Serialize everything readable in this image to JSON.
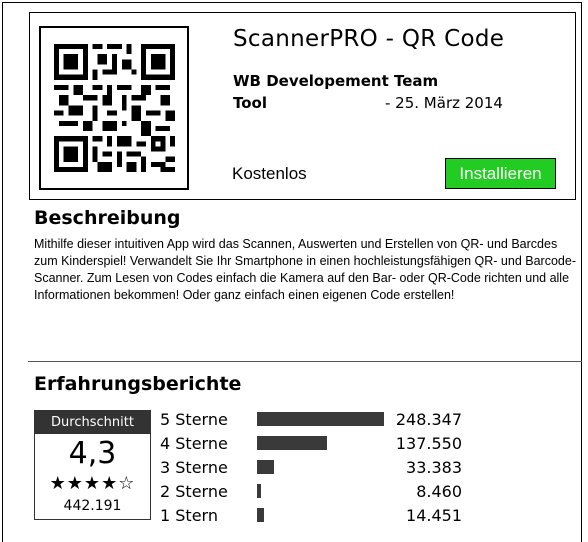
{
  "app": {
    "title": "ScannerPRO - QR Code",
    "developer": "WB Developement Team",
    "category": "Tool",
    "release_date": "- 25. März 2014",
    "price": "Kostenlos",
    "install_label": "Installieren",
    "install_color": "#22cc22",
    "qr_icon": "qr-code-icon"
  },
  "description": {
    "title": "Beschreibung",
    "text": "Mithilfe dieser intuitiven App wird das Scannen, Auswerten und Erstellen von QR- und Barcdes zum Kinderspiel! Verwandelt Sie Ihr Smartphone in einen hochleistungsfähigen QR- und Barcode-Scanner. Zum Lesen von Codes einfach die Kamera auf den Bar- oder QR-Code richten und alle Informationen bekommen! Oder ganz einfach einen eigenen Code erstellen!"
  },
  "reviews": {
    "title": "Erfahrungsberichte",
    "average_label": "Durchschnitt",
    "average_value": "4,3",
    "average_stars": "★★★★☆",
    "total_count": "442.191",
    "ratings": [
      {
        "label": "5 Sterne",
        "count": "248.347",
        "share": 1.0
      },
      {
        "label": "4 Sterne",
        "count": "137.550",
        "share": 0.55
      },
      {
        "label": "3 Sterne",
        "count": "33.383",
        "share": 0.134
      },
      {
        "label": "2 Sterne",
        "count": "8.460",
        "share": 0.034
      },
      {
        "label": "1 Stern",
        "count": "14.451",
        "share": 0.058
      }
    ]
  }
}
